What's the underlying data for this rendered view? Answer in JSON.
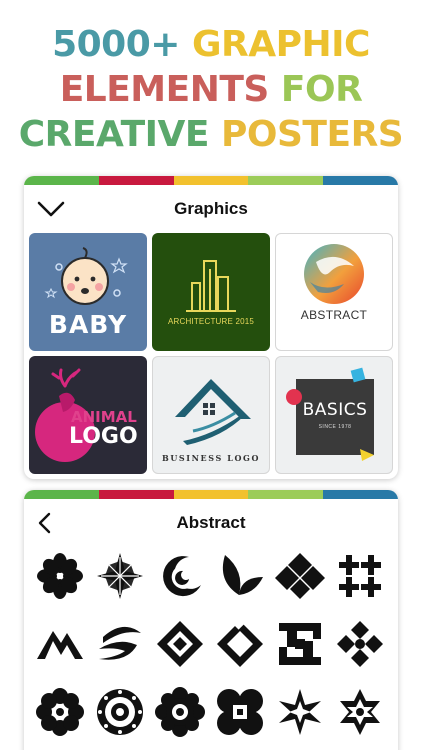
{
  "headline": {
    "line1": [
      {
        "text": "5000+ ",
        "color": "#4a9aa6"
      },
      {
        "text": "GRAPHIC",
        "color": "#ecc12f"
      }
    ],
    "line2": [
      {
        "text": "ELEMENTS ",
        "color": "#c95f5b"
      },
      {
        "text": "FOR",
        "color": "#9bc656"
      }
    ],
    "line3": [
      {
        "text": "CREATIVE ",
        "color": "#5aa86b"
      },
      {
        "text": "POSTERS",
        "color": "#e8b93a"
      }
    ]
  },
  "stripe_colors": [
    "#5bb54a",
    "#c8193e",
    "#f2c12e",
    "#9ccc59",
    "#2879a7"
  ],
  "graphics_panel": {
    "title": "Graphics",
    "collapse_icon": "chevron-down-icon",
    "tiles": [
      {
        "name": "baby",
        "label": "BABY"
      },
      {
        "name": "architecture",
        "label": "ARCHITECTURE 2015"
      },
      {
        "name": "abstract",
        "label": "ABSTRACT"
      },
      {
        "name": "animal-logo",
        "label_1": "ANIMAL",
        "label_2": "LOGO"
      },
      {
        "name": "business-logo",
        "label": "BUSINESS LOGO"
      },
      {
        "name": "basics",
        "label_1": "BASICS",
        "label_2": "SINCE 1978"
      }
    ]
  },
  "abstract_panel": {
    "title": "Abstract",
    "back_icon": "chevron-left-icon",
    "icons": [
      "flower-icon",
      "star-burst-icon",
      "crescent-swirl-icon",
      "leaf-pair-icon",
      "diamond-cluster-icon",
      "plus-grid-icon",
      "mountain-icon",
      "s-wave-icon",
      "nested-diamond-icon",
      "diamond-outline-icon",
      "meander-square-icon",
      "knot-icon",
      "rosette-icon",
      "mandala-icon",
      "gear-flower-icon",
      "quatrefoil-icon",
      "six-point-star-icon",
      "hex-star-icon"
    ]
  }
}
